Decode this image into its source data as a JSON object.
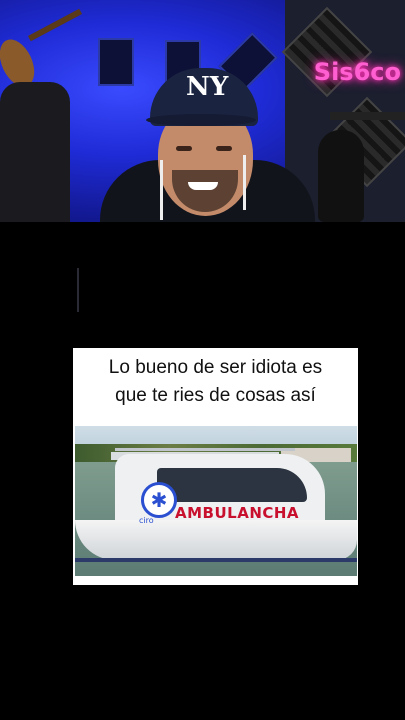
{
  "webcam": {
    "neon_sign": "Sis6co",
    "cap_logo": "NY"
  },
  "meme": {
    "caption_line1": "Lo bueno de ser idiota es",
    "caption_line2": "que te ries de cosas así",
    "boat_text": "AMBULANCHA",
    "boat_small_text": "ciro",
    "star_symbol": "✱"
  }
}
